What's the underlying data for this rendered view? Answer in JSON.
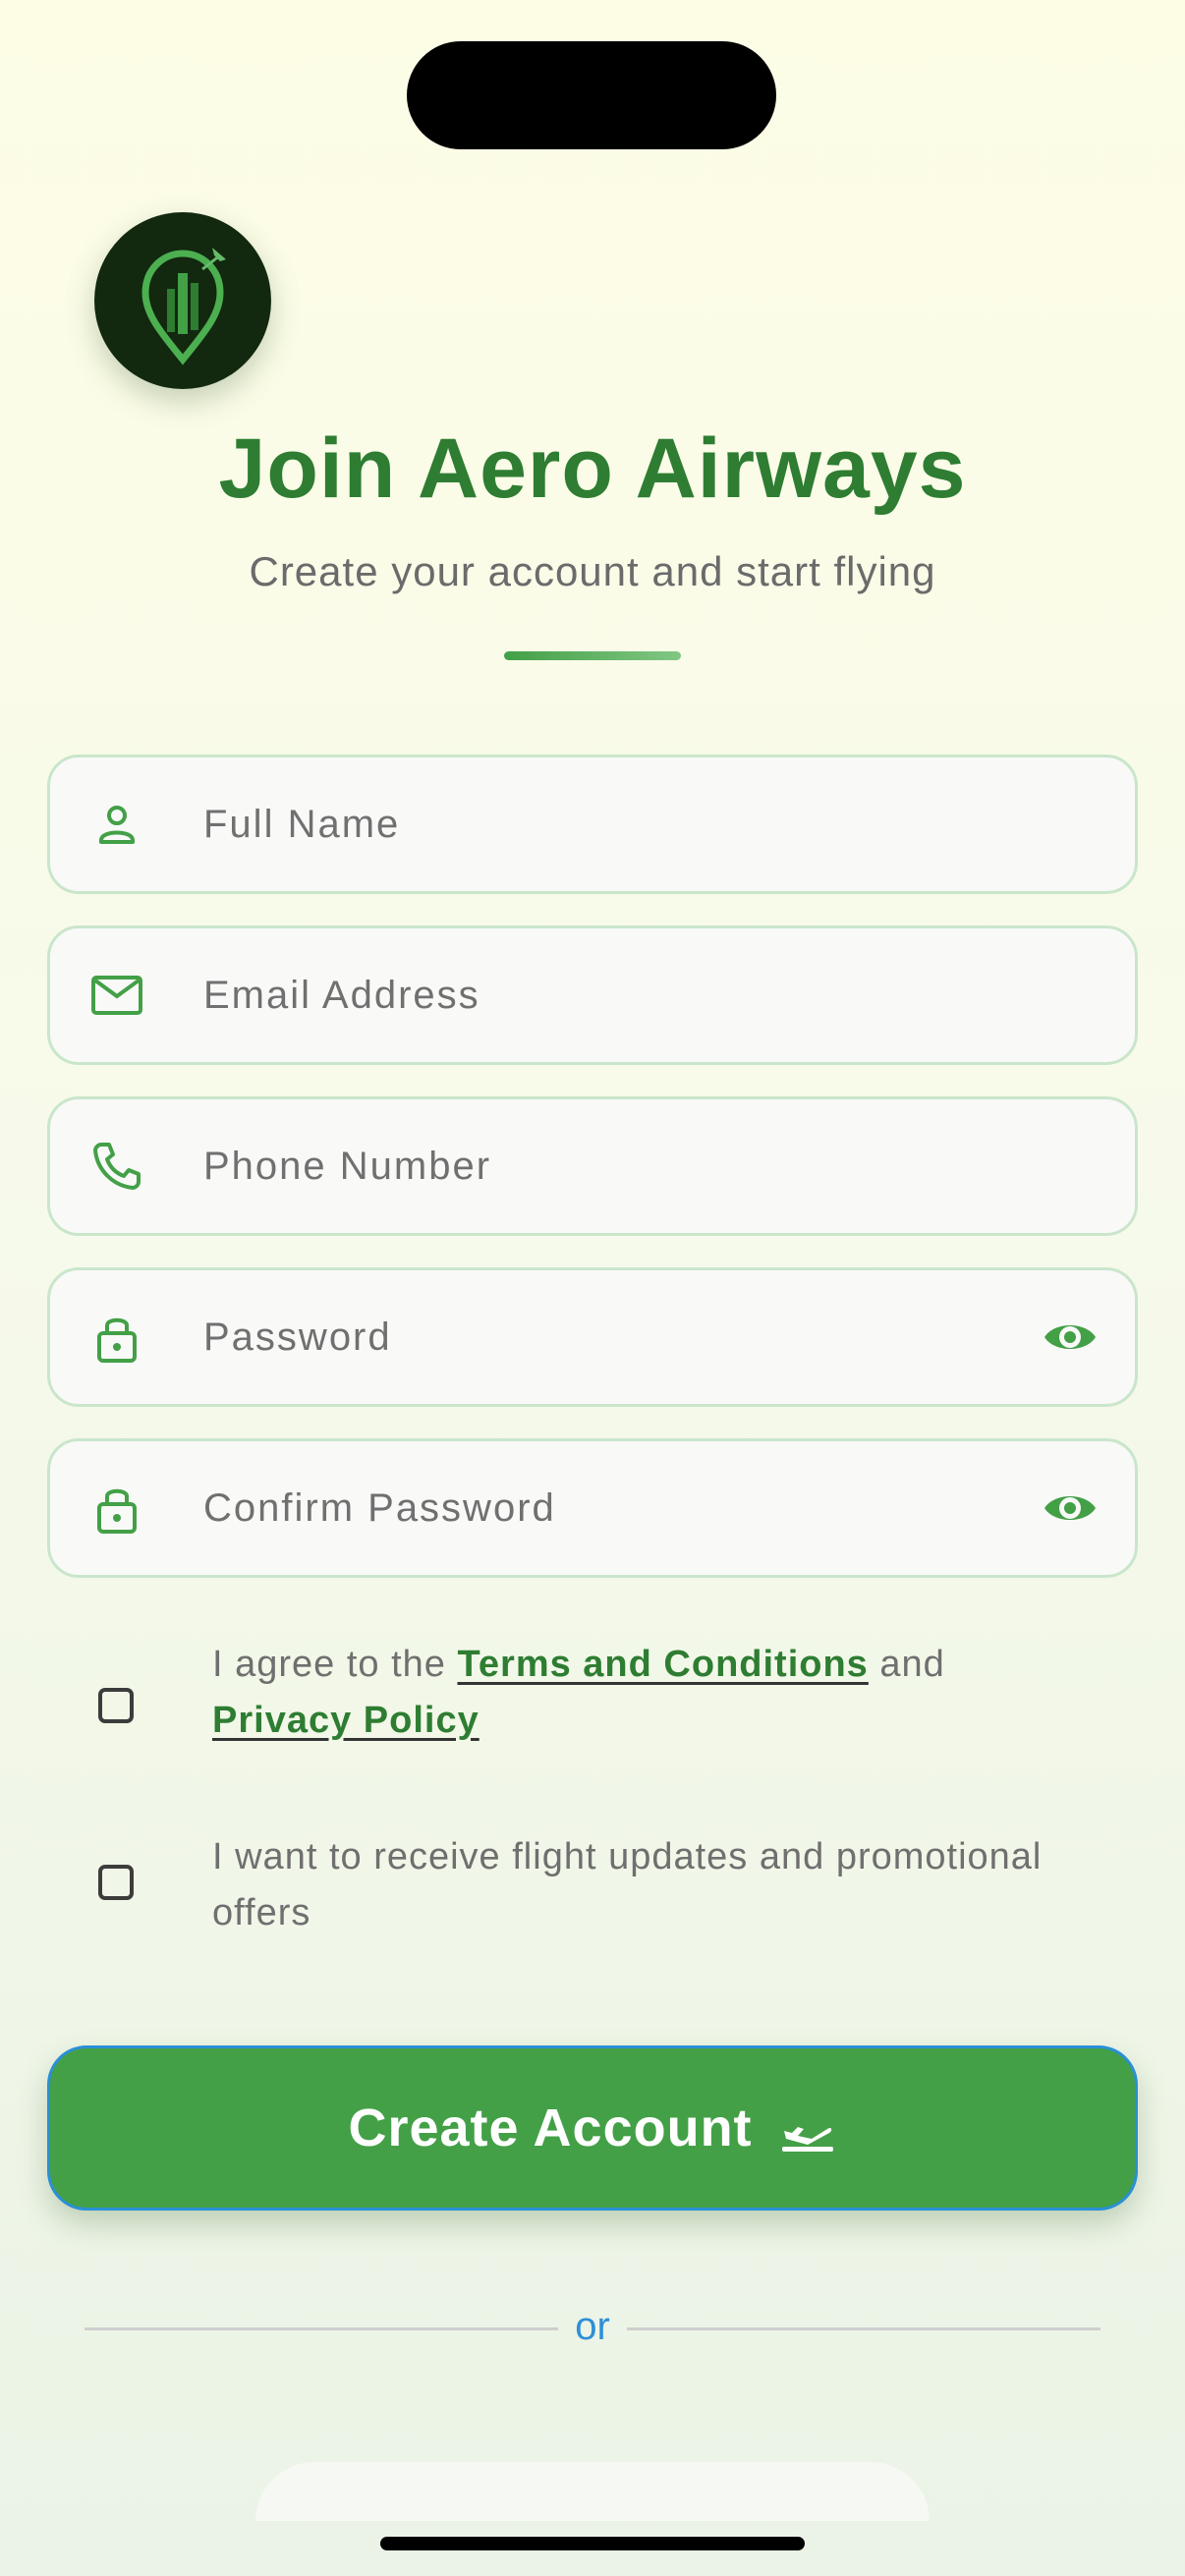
{
  "app": {
    "title": "Join Aero Airways",
    "subtitle": "Create your account and start flying"
  },
  "form": {
    "fields": [
      {
        "placeholder": "Full Name",
        "icon": "person-icon"
      },
      {
        "placeholder": "Email Address",
        "icon": "mail-icon"
      },
      {
        "placeholder": "Phone Number",
        "icon": "phone-icon"
      },
      {
        "placeholder": "Password",
        "icon": "lock-icon",
        "trailing_icon": "eye-icon"
      },
      {
        "placeholder": "Confirm Password",
        "icon": "lock-icon",
        "trailing_icon": "eye-icon"
      }
    ],
    "terms": {
      "prefix": "I agree to the",
      "terms_link": "Terms and Conditions",
      "middle": "and",
      "privacy_link": "Privacy Policy",
      "checked": false
    },
    "promo": {
      "text": "I want to receive flight updates and promotional offers",
      "checked": false
    },
    "submit_label": "Create Account",
    "submit_icon": "flight-takeoff-icon",
    "divider_text": "or"
  },
  "colors": {
    "primary": "#43a047",
    "primary_dark": "#2e7d32",
    "field_border": "#c9e6cb",
    "link_accent": "#2e8fd8"
  }
}
